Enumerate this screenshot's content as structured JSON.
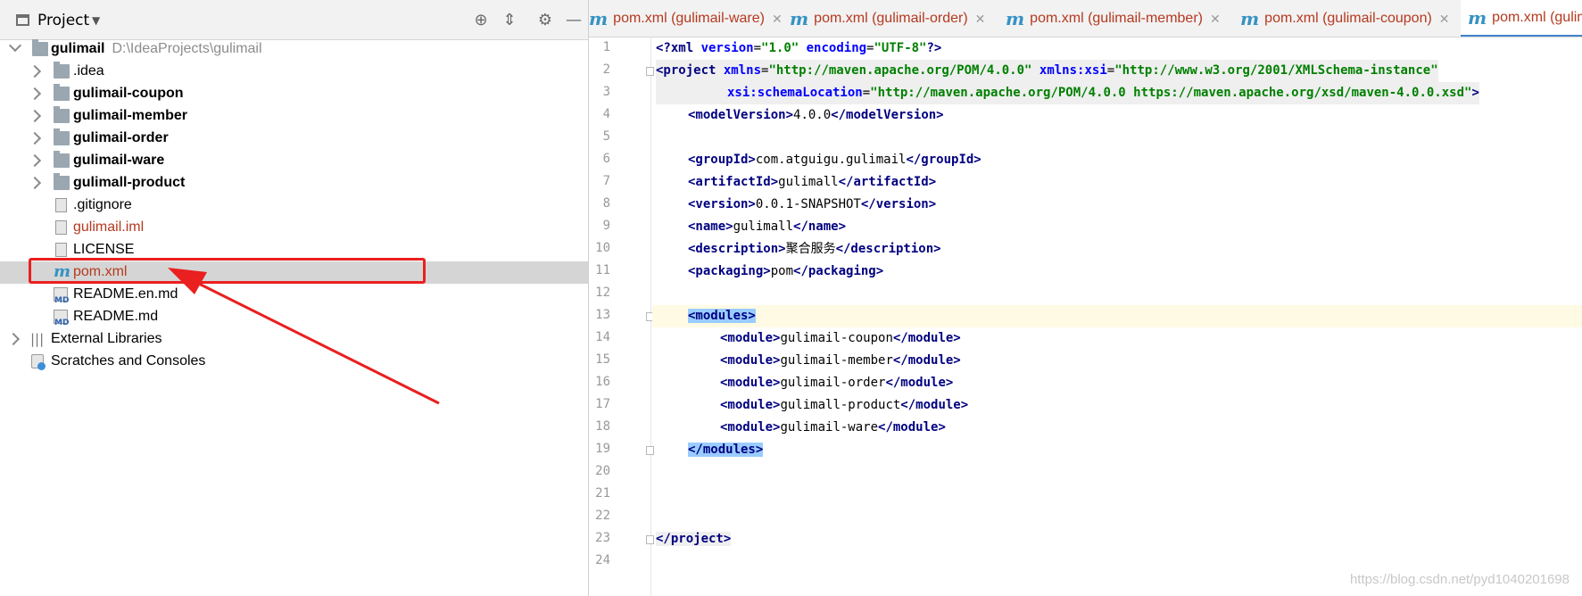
{
  "project_panel": {
    "title": "Project",
    "header_icons": [
      "locate-icon",
      "collapse-icon",
      "gear-icon",
      "minimize-icon"
    ],
    "tree": [
      {
        "label": "gulimail",
        "path": "D:\\IdeaProjects\\gulimail",
        "kind": "root"
      },
      {
        "label": ".idea",
        "kind": "folder"
      },
      {
        "label": "gulimail-coupon",
        "kind": "module"
      },
      {
        "label": "gulimail-member",
        "kind": "module"
      },
      {
        "label": "gulimail-order",
        "kind": "module"
      },
      {
        "label": "gulimail-ware",
        "kind": "module"
      },
      {
        "label": "gulimall-product",
        "kind": "module"
      },
      {
        "label": ".gitignore",
        "kind": "file"
      },
      {
        "label": "gulimail.iml",
        "kind": "iml"
      },
      {
        "label": "LICENSE",
        "kind": "file"
      },
      {
        "label": "pom.xml",
        "kind": "maven",
        "selected": true
      },
      {
        "label": "README.en.md",
        "kind": "md"
      },
      {
        "label": "README.md",
        "kind": "md"
      },
      {
        "label": "External Libraries",
        "kind": "libraries"
      },
      {
        "label": "Scratches and Consoles",
        "kind": "scratches"
      }
    ]
  },
  "editor": {
    "tabs": [
      {
        "label": "pom.xml (gulimail-ware)",
        "active": false
      },
      {
        "label": "pom.xml (gulimail-order)",
        "active": false
      },
      {
        "label": "pom.xml (gulimail-member)",
        "active": false
      },
      {
        "label": "pom.xml (gulimail-coupon)",
        "active": false
      },
      {
        "label": "pom.xml (gulimail",
        "active": true
      }
    ],
    "line_numbers": [
      "1",
      "2",
      "3",
      "4",
      "5",
      "6",
      "7",
      "8",
      "9",
      "10",
      "11",
      "12",
      "13",
      "14",
      "15",
      "16",
      "17",
      "18",
      "19",
      "20",
      "21",
      "22",
      "23",
      "24"
    ],
    "code": {
      "l1": [
        "<?",
        "xml ",
        "version",
        "=",
        "\"1.0\"",
        " encoding",
        "=",
        "\"UTF-8\"",
        "?>"
      ],
      "l2": [
        "<project ",
        "xmlns",
        "=",
        "\"http://maven.apache.org/POM/4.0.0\"",
        " xmlns:xsi",
        "=",
        "\"http://www.w3.org/2001/XMLSchema-instance\""
      ],
      "l3": [
        "xsi:schemaLocation",
        "=",
        "\"http://maven.apache.org/POM/4.0.0 https://maven.apache.org/xsd/maven-4.0.0.xsd\"",
        ">"
      ],
      "l4": [
        "<modelVersion>",
        "4.0.0",
        "</modelVersion>"
      ],
      "l6": [
        "<groupId>",
        "com.atguigu.gulimail",
        "</groupId>"
      ],
      "l7": [
        "<artifactId>",
        "gulimall",
        "</artifactId>"
      ],
      "l8": [
        "<version>",
        "0.0.1-SNAPSHOT",
        "</version>"
      ],
      "l9": [
        "<name>",
        "gulimall",
        "</name>"
      ],
      "l10": [
        "<description>",
        "聚合服务",
        "</description>"
      ],
      "l11": [
        "<packaging>",
        "pom",
        "</packaging>"
      ],
      "l13": [
        "<modules>"
      ],
      "l14": [
        "<module>",
        "gulimail-coupon",
        "</module>"
      ],
      "l15": [
        "<module>",
        "gulimail-member",
        "</module>"
      ],
      "l16": [
        "<module>",
        "gulimail-order",
        "</module>"
      ],
      "l17": [
        "<module>",
        "gulimall-product",
        "</module>"
      ],
      "l18": [
        "<module>",
        "gulimail-ware",
        "</module>"
      ],
      "l19": [
        "</modules>"
      ],
      "l23": [
        "</project>"
      ]
    }
  },
  "watermark": "https://blog.csdn.net/pyd1040201698",
  "colors": {
    "highlight_box": "#ea1f1f",
    "tag": "#000080",
    "attribute": "#0000ff",
    "string": "#008000",
    "selected_row": "#d5d5d5",
    "module_label": "#b5391f"
  }
}
